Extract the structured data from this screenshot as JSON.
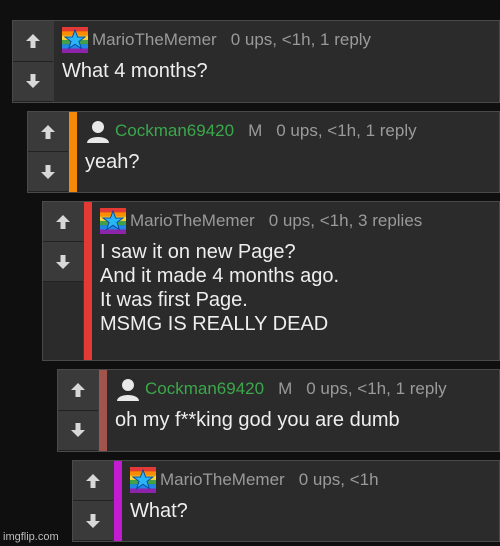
{
  "comments": [
    {
      "username": "MarioTheMemer",
      "user_style": "rainbow-avatar",
      "badge": "",
      "stats": "0 ups, <1h, 1 reply",
      "text": [
        "What 4 months?"
      ],
      "stripe_color": ""
    },
    {
      "username": "Cockman69420",
      "user_style": "default-avatar",
      "badge": "M",
      "stats": "0 ups, <1h, 1 reply",
      "text": [
        "yeah?"
      ],
      "stripe_color": "#f58a07"
    },
    {
      "username": "MarioTheMemer",
      "user_style": "rainbow-avatar",
      "badge": "",
      "stats": "0 ups, <1h, 3 replies",
      "text": [
        "I saw it on new Page?",
        "And it made 4 months ago.",
        "It was first Page.",
        "MSMG IS REALLY DEAD"
      ],
      "stripe_color": "#e53935"
    },
    {
      "username": "Cockman69420",
      "user_style": "default-avatar",
      "badge": "M",
      "stats": "0 ups, <1h, 1 reply",
      "text": [
        "oh my f**king god you are dumb"
      ],
      "stripe_color": "#a1544b"
    },
    {
      "username": "MarioTheMemer",
      "user_style": "rainbow-avatar",
      "badge": "",
      "stats": "0 ups, <1h",
      "text": [
        "What?"
      ],
      "stripe_color": "#c21bd1"
    }
  ],
  "watermark": "imgflip.com",
  "colors": {
    "background": "#0f0f0f",
    "card": "#2b2b2b",
    "green_username": "#3aa84a"
  }
}
